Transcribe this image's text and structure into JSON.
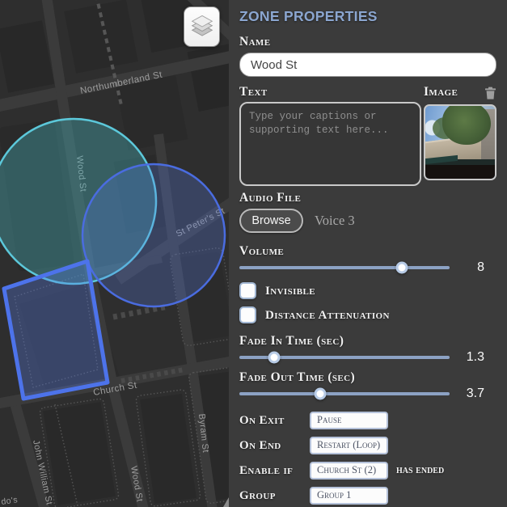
{
  "map": {
    "streets": {
      "northumberland": "Northumberland St",
      "wood_upper": "Wood St",
      "st_peters": "St Peter's St",
      "church": "Church St",
      "john_william": "John William St",
      "wood_lower": "Wood St",
      "byram": "Byram St",
      "corner_text": "do's"
    },
    "zones": {
      "teal_circle": {
        "color": "#5cc8da"
      },
      "blue_circle": {
        "color": "#4a6ce0"
      },
      "blue_rect": {
        "color": "#4d73ea"
      }
    }
  },
  "panel": {
    "title": "ZONE PROPERTIES",
    "name": {
      "label": "Name",
      "value": "Wood St"
    },
    "text": {
      "label": "Text",
      "placeholder": "Type your captions or supporting text here..."
    },
    "image": {
      "label": "Image"
    },
    "audio": {
      "label": "Audio File",
      "browse": "Browse",
      "file": "Voice 3"
    },
    "volume": {
      "label": "Volume",
      "value": "8",
      "pct": 77.3
    },
    "checkboxes": {
      "invisible": "Invisible",
      "distance": "Distance Attenuation"
    },
    "fade_in": {
      "label": "Fade In Time (sec)",
      "value": "1.3",
      "pct": 16.5
    },
    "fade_out": {
      "label": "Fade Out Time (sec)",
      "value": "3.7",
      "pct": 38.5
    },
    "rows": {
      "on_exit": {
        "label": "On Exit",
        "value": "Pause"
      },
      "on_end": {
        "label": "On End",
        "value": "Restart (Loop)"
      },
      "enable_if": {
        "label": "Enable if",
        "value": "Church St (2)",
        "suffix": "has ended"
      },
      "group": {
        "label": "Group",
        "value": "Group 1"
      }
    },
    "colors": {
      "accent": "#8ba6d0",
      "slider_track": "#8ca2c4"
    }
  }
}
